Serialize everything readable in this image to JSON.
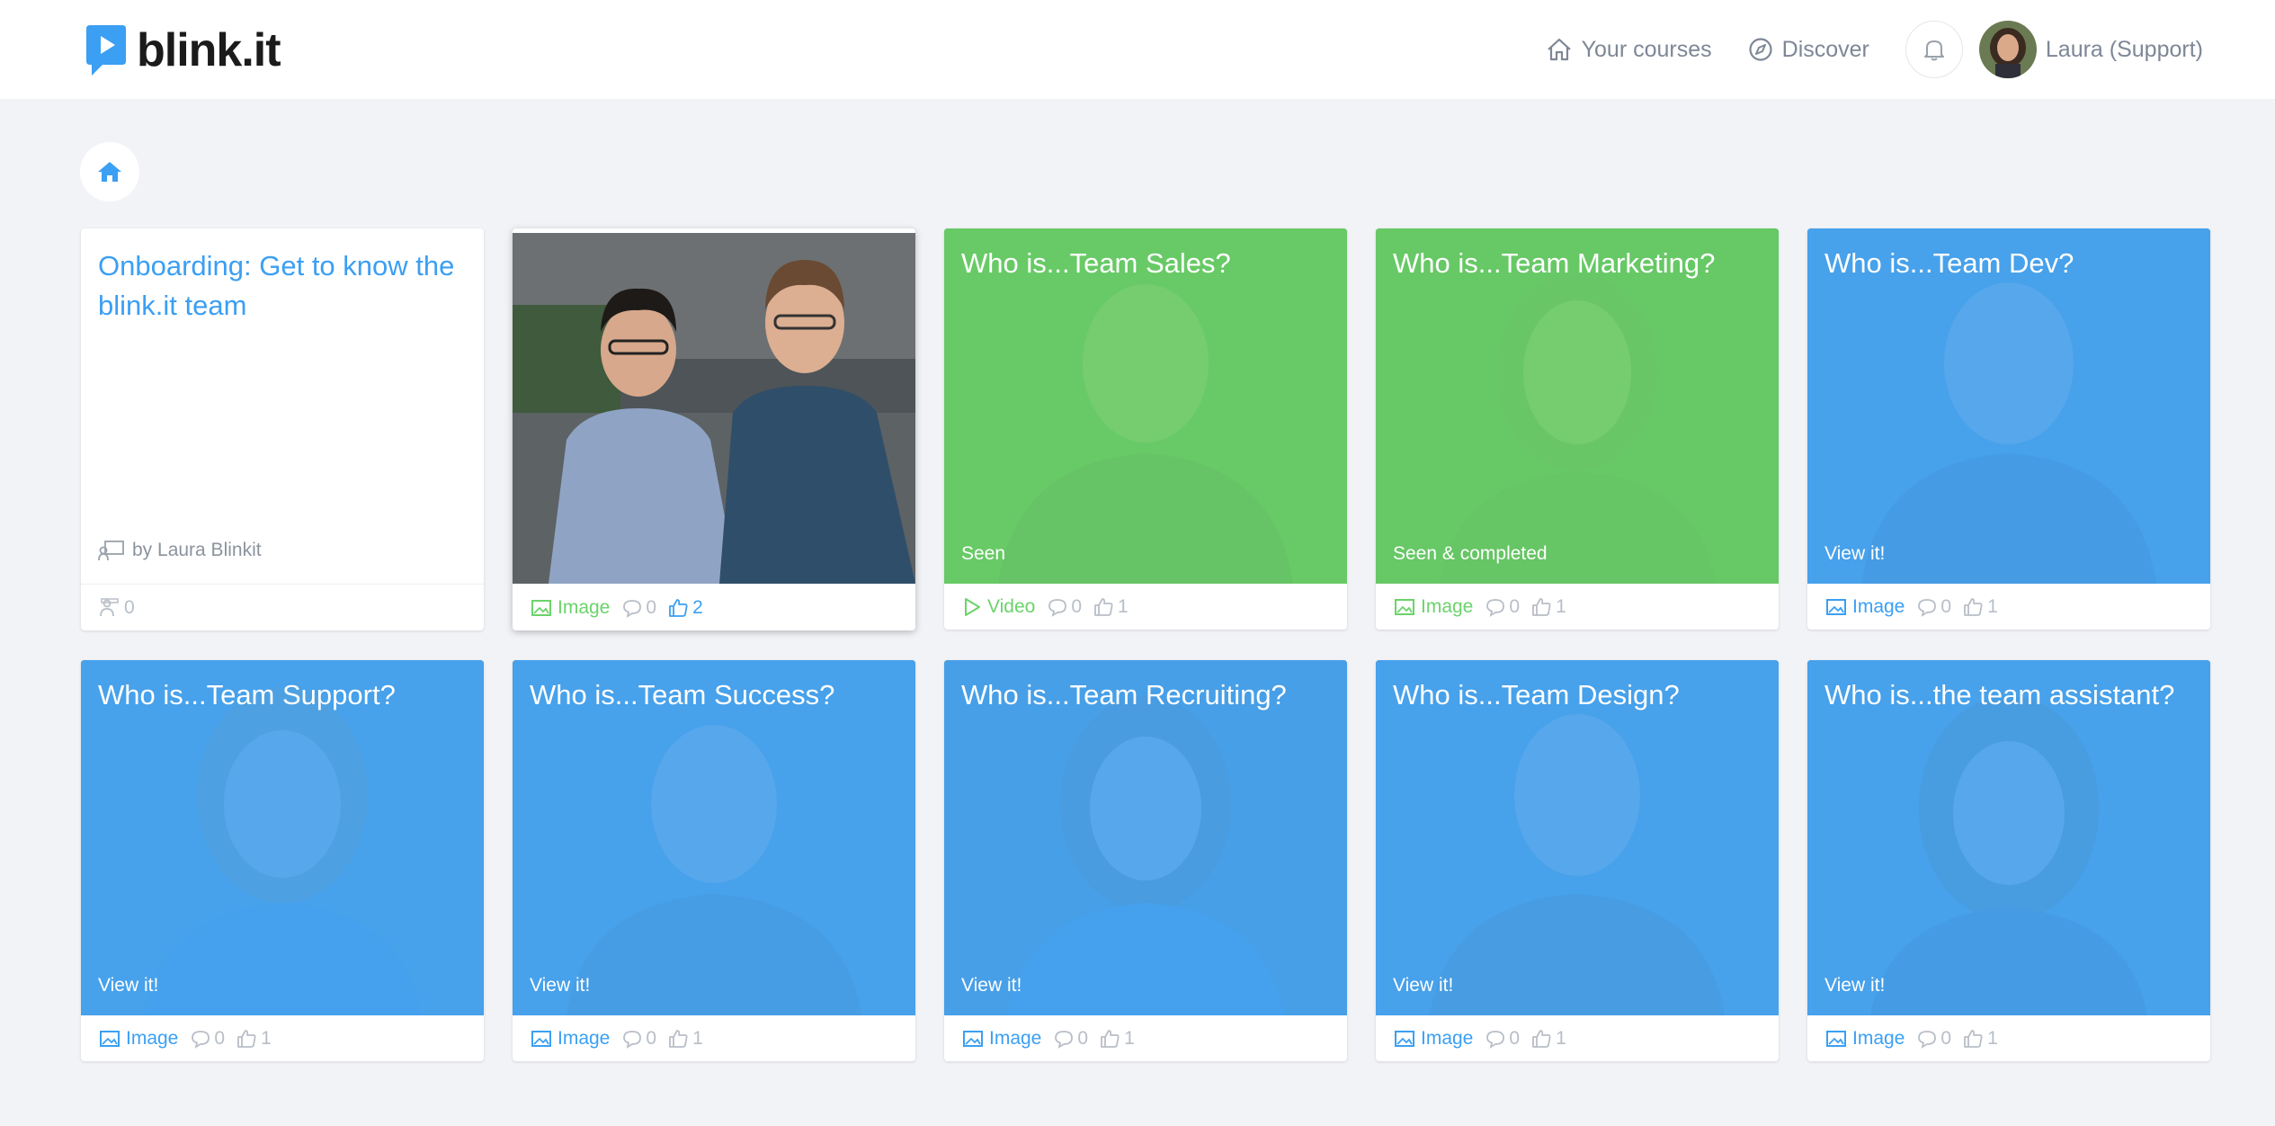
{
  "header": {
    "logo_text": "blink.it",
    "nav": [
      {
        "label": "Your courses",
        "icon": "home-outline-icon"
      },
      {
        "label": "Discover",
        "icon": "compass-icon"
      }
    ],
    "user_name": "Laura (Support)"
  },
  "colors": {
    "blue": "#4aa8f5",
    "green": "#6bd36b",
    "link_blue": "#3b9ff3"
  },
  "course": {
    "title": "Onboarding: Get to know the blink.it team",
    "author": "by Laura Blinkit",
    "participants": "0"
  },
  "cards": [
    {
      "title": "",
      "status": "",
      "type": "Image",
      "comments": "0",
      "likes": "2",
      "state": "photo"
    },
    {
      "title": "Who is...Team Sales?",
      "status": "Seen",
      "type": "Video",
      "comments": "0",
      "likes": "1",
      "state": "green"
    },
    {
      "title": "Who is...Team Marketing?",
      "status": "Seen & completed",
      "type": "Image",
      "comments": "0",
      "likes": "1",
      "state": "green"
    },
    {
      "title": "Who is...Team Dev?",
      "status": "View it!",
      "type": "Image",
      "comments": "0",
      "likes": "1",
      "state": "blue"
    },
    {
      "title": "Who is...Team Support?",
      "status": "View it!",
      "type": "Image",
      "comments": "0",
      "likes": "1",
      "state": "blue"
    },
    {
      "title": "Who is...Team Success?",
      "status": "View it!",
      "type": "Image",
      "comments": "0",
      "likes": "1",
      "state": "blue"
    },
    {
      "title": "Who is...Team Recruiting?",
      "status": "View it!",
      "type": "Image",
      "comments": "0",
      "likes": "1",
      "state": "blue"
    },
    {
      "title": "Who is...Team Design?",
      "status": "View it!",
      "type": "Image",
      "comments": "0",
      "likes": "1",
      "state": "blue"
    },
    {
      "title": "Who is...the team assistant?",
      "status": "View it!",
      "type": "Image",
      "comments": "0",
      "likes": "1",
      "state": "blue"
    }
  ]
}
